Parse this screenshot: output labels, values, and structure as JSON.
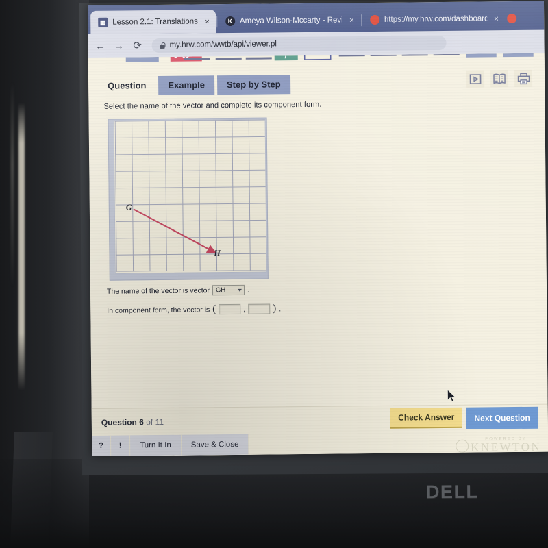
{
  "browser": {
    "tabs": [
      {
        "title": "Lesson 2.1: Translations",
        "favicon": "document-icon",
        "active": true,
        "close_label": "×"
      },
      {
        "title": "Ameya Wilson-Mccarty - Revised",
        "favicon": "knewton-k-icon",
        "active": false,
        "close_label": "×"
      },
      {
        "title": "https://my.hrw.com/dashboard/",
        "favicon": "red-dot-icon",
        "active": false,
        "close_label": "×"
      }
    ],
    "nav": {
      "back": "←",
      "forward": "→",
      "reload": "⟳"
    },
    "url": "my.hrw.com/wwtb/api/viewer.pl"
  },
  "lesson": {
    "tabs": [
      {
        "label": "Question",
        "active": true
      },
      {
        "label": "Example",
        "active": false
      },
      {
        "label": "Step by Step",
        "active": false
      }
    ],
    "tool_icons": [
      {
        "name": "play-video-icon"
      },
      {
        "name": "book-icon"
      },
      {
        "name": "print-icon"
      }
    ],
    "prompt": "Select the name of the vector and complete its component form.",
    "answer_rows": {
      "name_prefix": "The name of the vector is vector",
      "name_value": "GH",
      "name_suffix": ".",
      "component_prefix": "In component form, the vector is",
      "open_paren": "(",
      "comma": ",",
      "close_paren": ")",
      "period": ".",
      "component_x": "",
      "component_y": "",
      "component_placeholder": ""
    }
  },
  "chart_data": {
    "type": "scatter",
    "title": "",
    "xlabel": "",
    "ylabel": "",
    "grid": true,
    "grid_columns": 9,
    "grid_rows": 9,
    "xlim": [
      0,
      9
    ],
    "ylim": [
      0,
      9
    ],
    "annotations": [
      {
        "label": "G",
        "x": 1,
        "y": 3.6,
        "type": "vector-tail"
      },
      {
        "label": "H",
        "x": 6,
        "y": 1,
        "type": "vector-head"
      }
    ],
    "series": [
      {
        "name": "vector GH",
        "type": "arrow",
        "color": "#c94a63",
        "from": {
          "label": "G",
          "x": 1,
          "y": 3.6
        },
        "to": {
          "label": "H",
          "x": 6,
          "y": 1
        }
      }
    ]
  },
  "footer": {
    "question_counter_bold": "Question 6",
    "question_counter_light": "of 11",
    "check_answer": "Check Answer",
    "next_question": "Next Question",
    "help_label": "?",
    "info_label": "!",
    "turn_it_in": "Turn It In",
    "save_and_close": "Save & Close",
    "powered_by": "POWERED BY",
    "brand": "KNEWTON"
  },
  "hardware": {
    "monitor_brand_d": "D",
    "monitor_brand_o": "╱",
    "monitor_brand_ell": "LL",
    "monitor_brand_full": "DELL"
  },
  "colors": {
    "tabstrip": "#4e5c8c",
    "page_bg": "#f5f1e2",
    "tab_inactive": "#8f9cc0",
    "vector": "#c94a63",
    "grid_line": "#8d93b0",
    "check_answer": "#f4dd8e",
    "next_question": "#6f9ad3"
  }
}
